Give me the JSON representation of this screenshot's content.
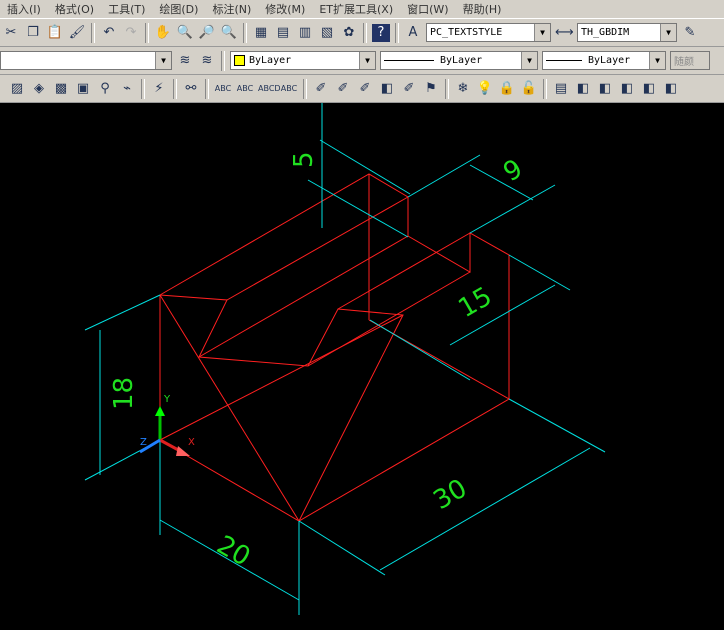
{
  "menu": [
    "插入(I)",
    "格式(O)",
    "工具(T)",
    "绘图(D)",
    "标注(N)",
    "修改(M)",
    "ET扩展工具(X)",
    "窗口(W)",
    "帮助(H)"
  ],
  "toolbar": {
    "text_style": "PC_TEXTSTYLE",
    "dim_style": "TH_GBDIM",
    "color": "ByLayer",
    "linetype": "ByLayer",
    "lineweight": "ByLayer",
    "plot_style": "随颜"
  },
  "dimensions": {
    "d5": "5",
    "d9": "9",
    "d15": "15",
    "d18": "18",
    "d20": "20",
    "d30": "30"
  },
  "ucs": {
    "x": "X",
    "y": "Y",
    "z": "Z"
  },
  "colors": {
    "geometry": "#ff2020",
    "dims": "#00e0e0",
    "dim_text": "#20e020"
  }
}
